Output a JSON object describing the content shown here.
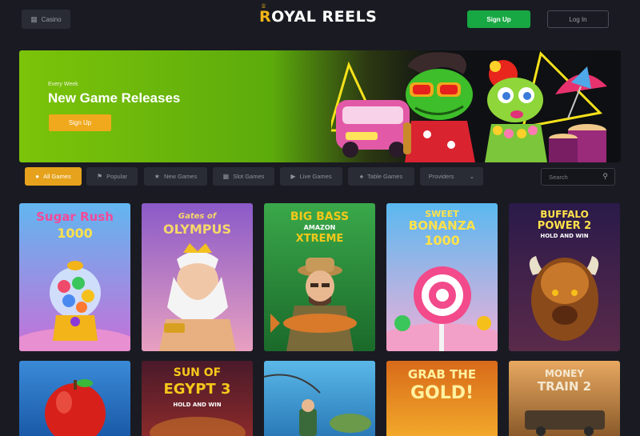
{
  "header": {
    "casino_label": "Casino",
    "casino_icon": "casino-icon",
    "logo_first": "R",
    "logo_rest": "OYAL REELS",
    "signup_label": "Sign Up",
    "login_label": "Log In"
  },
  "banner": {
    "kicker": "Every Week",
    "title": "New Game Releases",
    "cta_label": "Sign Up"
  },
  "filters": {
    "items": [
      {
        "label": "All Games",
        "icon": "all-games-icon",
        "active": true
      },
      {
        "label": "Popular",
        "icon": "popular-icon",
        "active": false
      },
      {
        "label": "New Games",
        "icon": "new-games-icon",
        "active": false
      },
      {
        "label": "Slot Games",
        "icon": "slot-games-icon",
        "active": false
      },
      {
        "label": "Live Games",
        "icon": "live-games-icon",
        "active": false
      },
      {
        "label": "Table Games",
        "icon": "table-games-icon",
        "active": false
      }
    ],
    "providers_label": "Providers",
    "search_placeholder": "Search"
  },
  "games": [
    {
      "title_lines": [
        "Sugar Rush",
        "1000"
      ]
    },
    {
      "title_lines": [
        "Gates of",
        "OLYMPUS"
      ]
    },
    {
      "title_lines": [
        "BIG BASS",
        "AMAZON",
        "XTREME"
      ]
    },
    {
      "title_lines": [
        "SWEET",
        "BONANZA",
        "1000"
      ]
    },
    {
      "title_lines": [
        "BUFFALO",
        "POWER 2",
        "HOLD AND WIN"
      ]
    },
    {
      "title_lines": []
    },
    {
      "title_lines": [
        "SUN OF",
        "EGYPT 3",
        "HOLD AND WIN"
      ]
    },
    {
      "title_lines": []
    },
    {
      "title_lines": [
        "GRAB THE",
        "GOLD!"
      ]
    },
    {
      "title_lines": [
        "MONEY",
        "TRAIN 2"
      ]
    }
  ],
  "colors": {
    "bg": "#1a1b22",
    "accent": "#e6a21c",
    "signup_green": "#18a843",
    "banner_green": "#7cc40a"
  }
}
